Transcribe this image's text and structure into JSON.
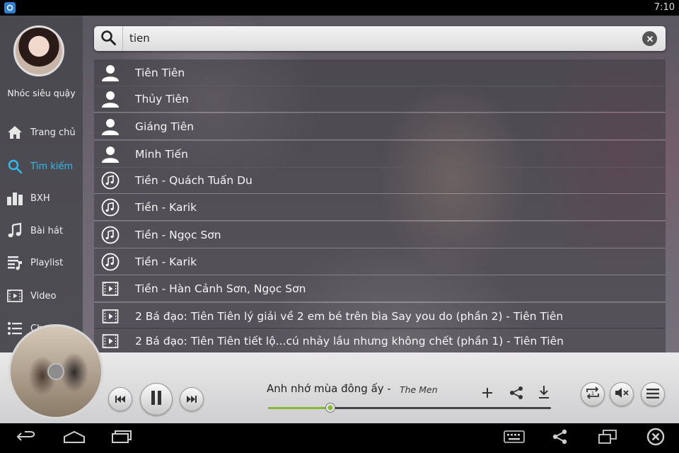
{
  "status_bar": {
    "time": "7:10",
    "app_icon": "app-icon"
  },
  "sidebar": {
    "username": "Nhóc siêu quậy",
    "items": [
      {
        "label": "Trang chủ",
        "icon": "home-icon",
        "active": false
      },
      {
        "label": "Tìm kiếm",
        "icon": "search-icon",
        "active": true
      },
      {
        "label": "BXH",
        "icon": "chart-icon",
        "active": false
      },
      {
        "label": "Bài hát",
        "icon": "music-note-icon",
        "active": false
      },
      {
        "label": "Playlist",
        "icon": "playlist-icon",
        "active": false
      },
      {
        "label": "Video",
        "icon": "video-icon",
        "active": false
      },
      {
        "label": "Ch",
        "icon": "list-icon",
        "active": false
      }
    ]
  },
  "search": {
    "value": "tien",
    "icon": "search-icon",
    "clear_icon": "close-icon"
  },
  "results": [
    {
      "type": "artist",
      "icon": "person-icon",
      "text": "Tiên Tiên"
    },
    {
      "type": "artist",
      "icon": "person-icon",
      "text": "Thủy Tiên"
    },
    {
      "type": "artist",
      "icon": "person-icon",
      "text": "Giáng Tiên"
    },
    {
      "type": "artist",
      "icon": "person-icon",
      "text": "Minh Tiến"
    },
    {
      "type": "song",
      "icon": "music-note-icon",
      "text": "Tiền - Quách Tuấn Du"
    },
    {
      "type": "song",
      "icon": "music-note-icon",
      "text": "Tiền - Karik"
    },
    {
      "type": "song",
      "icon": "music-note-icon",
      "text": "Tiền - Ngọc Sơn"
    },
    {
      "type": "song",
      "icon": "music-note-icon",
      "text": "Tiền - Karik"
    },
    {
      "type": "video",
      "icon": "video-icon",
      "text": "Tiền - Hàn Cảnh Sơn, Ngọc Sơn"
    },
    {
      "type": "video",
      "icon": "video-icon",
      "text": "2 Bá đạo: Tiên Tiên lý giải về 2 em bé trên bìa Say you do (phần 2) - Tiên Tiên"
    },
    {
      "type": "video",
      "icon": "video-icon",
      "text": "2 Bá đạo: Tiên Tiên tiết lộ...cú nhảy lầu nhưng không chết (phần 1) - Tiên Tiên"
    }
  ],
  "player": {
    "title": "Anh nhớ mùa đông ấy -",
    "artist": "The Men",
    "progress": 0.22,
    "state": "playing",
    "controls": [
      "previous-icon",
      "pause-icon",
      "next-icon"
    ],
    "actions": [
      "add-icon",
      "share-icon",
      "download-icon"
    ],
    "extra": [
      "repeat-one-icon",
      "mute-icon",
      "menu-icon"
    ],
    "accent_color": "#8ab63a"
  },
  "nav_bar": [
    "back-icon",
    "home-icon",
    "recent-apps-icon",
    "keyboard-icon",
    "share-icon",
    "window-icon",
    "close-icon"
  ]
}
